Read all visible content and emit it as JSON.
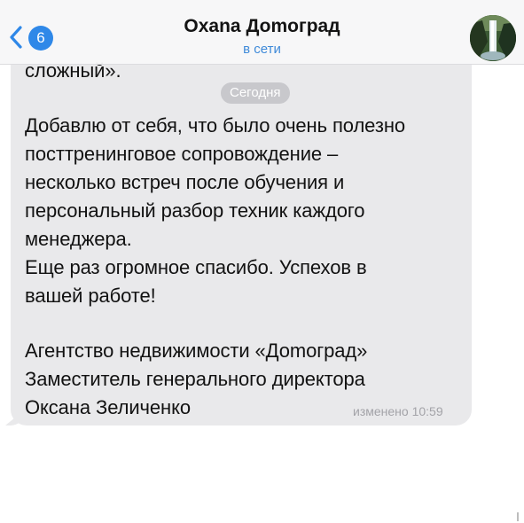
{
  "header": {
    "back_badge_count": "6",
    "contact_name": "Охаnа Доmоград",
    "status": "в сети"
  },
  "chat": {
    "previous_message_tail": "сложный».",
    "date_divider": "Сегодня",
    "message_lines": [
      "Добавлю от себя, что было очень полезно",
      "посттренинговое сопровождение –",
      "несколько встреч после обучения и",
      "персональный разбор техник каждого",
      "менеджера.",
      "Еще раз огромное спасибо. Успехов в",
      "вашей работе!",
      "Агентство недвижимости «Доmоград»",
      "Заместитель генерального директора",
      "Оксана Зеличенко"
    ],
    "edited_label": "изменено 10:59"
  },
  "colors": {
    "accent": "#2f88e8",
    "bubble": "#e9e9eb",
    "status_text": "#3f8ad9"
  },
  "icons": {
    "back": "chevron-left-icon",
    "avatar": "waterfall-avatar"
  }
}
